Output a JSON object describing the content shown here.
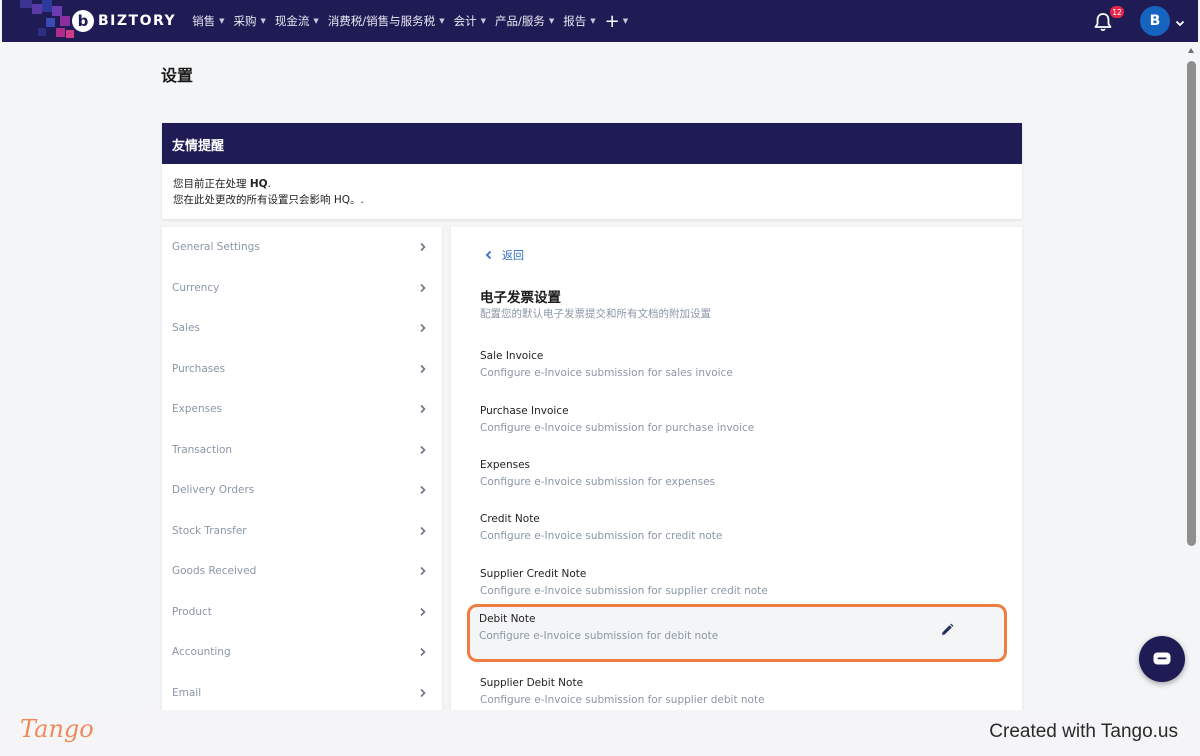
{
  "nav": {
    "brand": "BIZTORY",
    "brand_mark": "b",
    "items": [
      "销售",
      "采购",
      "现金流",
      "消费税/销售与服务税",
      "会计",
      "产品/服务",
      "报告"
    ],
    "plus": "+",
    "notification_count": "12",
    "avatar_initial": "B"
  },
  "page": {
    "title": "设置"
  },
  "notice": {
    "heading": "友情提醒",
    "line1_prefix": "您目前正在处理 ",
    "line1_entity": "HQ",
    "line1_suffix": ".",
    "line2": "您在此处更改的所有设置只会影响 HQ。."
  },
  "sidebar": {
    "items": [
      "General Settings",
      "Currency",
      "Sales",
      "Purchases",
      "Expenses",
      "Transaction",
      "Delivery Orders",
      "Stock Transfer",
      "Goods Received",
      "Product",
      "Accounting",
      "Email"
    ]
  },
  "content": {
    "back_label": "返回",
    "section_title": "电子发票设置",
    "section_subtitle": "配置您的默认电子发票提交和所有文档的附加设置",
    "options": [
      {
        "title": "Sale Invoice",
        "desc": "Configure e-Invoice submission for sales invoice"
      },
      {
        "title": "Purchase Invoice",
        "desc": "Configure e-Invoice submission for purchase invoice"
      },
      {
        "title": "Expenses",
        "desc": "Configure e-Invoice submission for expenses"
      },
      {
        "title": "Credit Note",
        "desc": "Configure e-Invoice submission for credit note"
      },
      {
        "title": "Supplier Credit Note",
        "desc": "Configure e-Invoice submission for supplier credit note"
      },
      {
        "title": "Debit Note",
        "desc": "Configure e-Invoice submission for debit note"
      },
      {
        "title": "Supplier Debit Note",
        "desc": "Configure e-Invoice submission for supplier debit note"
      }
    ]
  },
  "footer": {
    "logo": "Tango",
    "created_with": "Created with Tango.us"
  },
  "colors": {
    "nav_bg": "#1f1c55",
    "accent_link": "#2f6fc7",
    "highlight_border": "#ef7d41",
    "badge": "#e6284b"
  }
}
